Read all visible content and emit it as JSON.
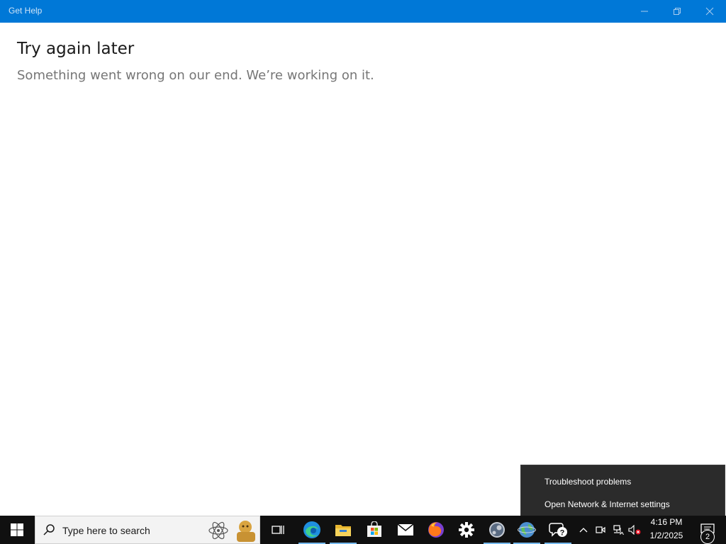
{
  "window": {
    "title": "Get Help",
    "accent_color": "#0078d7"
  },
  "main": {
    "heading": "Try again later",
    "message": "Something went wrong on our end. We’re working on it."
  },
  "context_menu": {
    "items": [
      {
        "label": "Troubleshoot problems"
      },
      {
        "label": "Open Network & Internet settings"
      }
    ]
  },
  "taskbar": {
    "search_placeholder": "Type here to search",
    "pinned": [
      {
        "name": "task-view-icon"
      },
      {
        "name": "edge-icon",
        "active": true
      },
      {
        "name": "file-explorer-icon",
        "active": true
      },
      {
        "name": "microsoft-store-icon"
      },
      {
        "name": "mail-icon"
      },
      {
        "name": "firefox-icon"
      },
      {
        "name": "settings-gear-icon"
      },
      {
        "name": "steam-icon",
        "active": true
      },
      {
        "name": "globe-icon",
        "active": true
      },
      {
        "name": "get-help-icon",
        "active": true
      }
    ],
    "clock_time": "4:16 PM",
    "clock_date": "1/2/2025",
    "notification_count": "2"
  }
}
